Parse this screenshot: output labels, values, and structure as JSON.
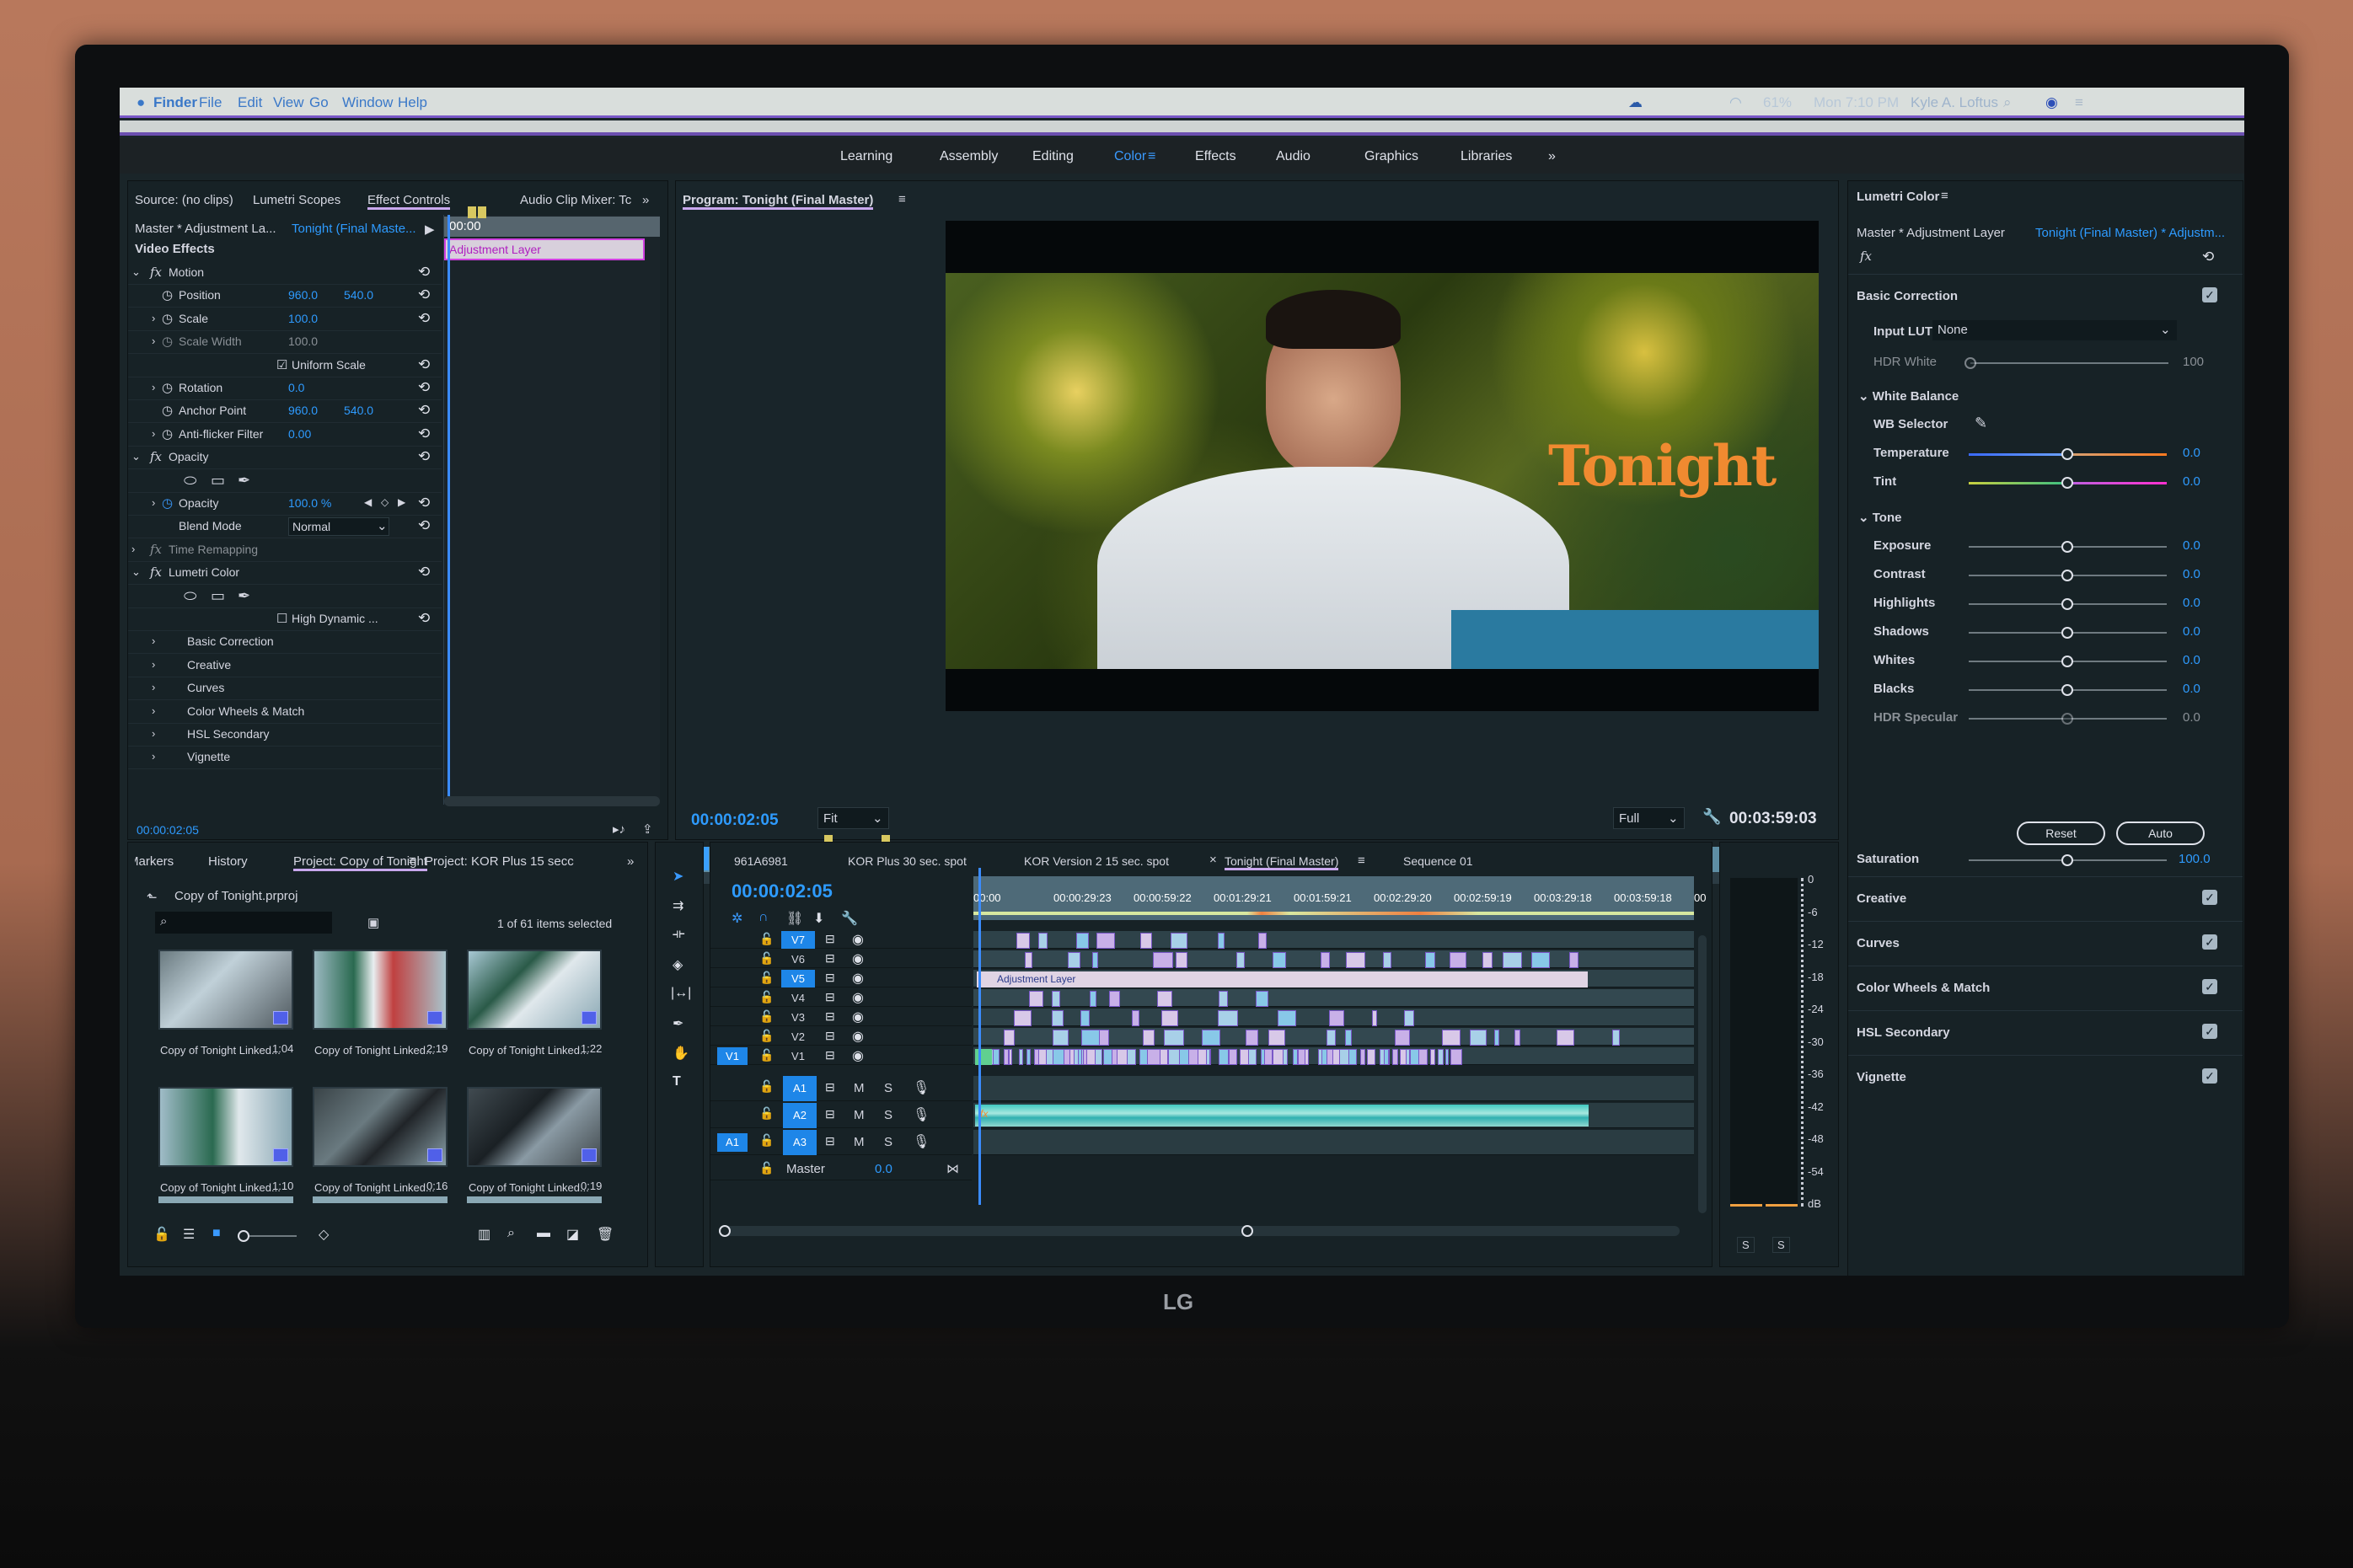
{
  "menubar": {
    "apple": "",
    "items": [
      "Finder",
      "File",
      "Edit",
      "View",
      "Go",
      "Window",
      "Help"
    ],
    "battery": "61%",
    "clock": "Mon 7:10 PM",
    "user": "Kyle A. Loftus"
  },
  "workspaces": {
    "items": [
      "Learning",
      "Assembly",
      "Editing",
      "Color",
      "Effects",
      "Audio",
      "Graphics",
      "Libraries"
    ],
    "active": "Color",
    "more": "»"
  },
  "left_panel": {
    "tabs": [
      "Source: (no clips)",
      "Lumetri Scopes",
      "Effect Controls",
      "Audio Clip Mixer: Tc"
    ],
    "active_tab": "Effect Controls",
    "master": "Master * Adjustment La...",
    "sequence": "Tonight (Final Maste...",
    "timeline_start": "00:00",
    "clip_label": "Adjustment Layer",
    "section": "Video Effects",
    "rows": [
      {
        "indent": 1,
        "label": "Motion",
        "fx": true
      },
      {
        "indent": 2,
        "label": "Position",
        "v1": "960.0",
        "v2": "540.0"
      },
      {
        "indent": 2,
        "label": "Scale",
        "v1": "100.0"
      },
      {
        "indent": 2,
        "label": "Scale Width",
        "v1": "100.0",
        "disabled": true
      },
      {
        "indent": 3,
        "label": "Uniform Scale",
        "checkbox": true,
        "checked": true
      },
      {
        "indent": 2,
        "label": "Rotation",
        "v1": "0.0"
      },
      {
        "indent": 2,
        "label": "Anchor Point",
        "v1": "960.0",
        "v2": "540.0"
      },
      {
        "indent": 2,
        "label": "Anti-flicker Filter",
        "v1": "0.00"
      },
      {
        "indent": 1,
        "label": "Opacity",
        "fx": true
      },
      {
        "indent": 2,
        "label": "",
        "masks": true
      },
      {
        "indent": 2,
        "label": "Opacity",
        "v1": "100.0 %"
      },
      {
        "indent": 2,
        "label": "Blend Mode",
        "select": "Normal"
      },
      {
        "indent": 1,
        "label": "Time Remapping",
        "fx": true,
        "disabled": true
      },
      {
        "indent": 1,
        "label": "Lumetri Color",
        "fx": true
      },
      {
        "indent": 2,
        "label": "",
        "masks": true
      },
      {
        "indent": 3,
        "label": "High Dynamic ...",
        "checkbox": true,
        "checked": false
      },
      {
        "indent": 2,
        "label": "Basic Correction"
      },
      {
        "indent": 2,
        "label": "Creative"
      },
      {
        "indent": 2,
        "label": "Curves"
      },
      {
        "indent": 2,
        "label": "Color Wheels & Match"
      },
      {
        "indent": 2,
        "label": "HSL Secondary"
      },
      {
        "indent": 2,
        "label": "Vignette"
      }
    ],
    "timecode": "00:00:02:05"
  },
  "program": {
    "title": "Program: Tonight (Final Master)",
    "overlay_text": "Tonight",
    "timecode": "00:00:02:05",
    "zoom": "Fit",
    "quality": "Full",
    "duration": "00:03:59:03",
    "playhead_fraction": 0.01
  },
  "lumetri": {
    "title": "Lumetri Color",
    "master": "Master * Adjustment Layer",
    "sequence": "Tonight (Final Master) * Adjustm...",
    "basic_correction": "Basic Correction",
    "input_lut_label": "Input LUT",
    "input_lut": "None",
    "hdr_white_label": "HDR White",
    "hdr_white": "100",
    "white_balance": "White Balance",
    "wb_selector": "WB Selector",
    "wb_sliders": [
      {
        "label": "Temperature",
        "value": "0.0"
      },
      {
        "label": "Tint",
        "value": "0.0"
      }
    ],
    "tone": "Tone",
    "tone_sliders": [
      {
        "label": "Exposure",
        "value": "0.0"
      },
      {
        "label": "Contrast",
        "value": "0.0"
      },
      {
        "label": "Highlights",
        "value": "0.0"
      },
      {
        "label": "Shadows",
        "value": "0.0"
      },
      {
        "label": "Whites",
        "value": "0.0"
      },
      {
        "label": "Blacks",
        "value": "0.0"
      },
      {
        "label": "HDR Specular",
        "value": "0.0",
        "disabled": true
      }
    ],
    "reset": "Reset",
    "auto": "Auto",
    "saturation_label": "Saturation",
    "saturation": "100.0",
    "sections": [
      {
        "label": "Creative",
        "checked": true
      },
      {
        "label": "Curves",
        "checked": true
      },
      {
        "label": "Color Wheels & Match",
        "checked": true
      },
      {
        "label": "HSL Secondary",
        "checked": true
      },
      {
        "label": "Vignette",
        "checked": true
      }
    ]
  },
  "project": {
    "tabs": [
      "Markers",
      "History",
      "Project: Copy of Tonight",
      "Project: KOR Plus 15 secc"
    ],
    "active_tab": "Project: Copy of Tonight",
    "file": "Copy of Tonight.prproj",
    "search_placeholder": "",
    "selection": "1 of 61 items selected",
    "items": [
      {
        "name": "Copy of Tonight Linked...",
        "dur": "1:04"
      },
      {
        "name": "Copy of Tonight Linked...",
        "dur": "2:19"
      },
      {
        "name": "Copy of Tonight Linked...",
        "dur": "1:22"
      },
      {
        "name": "Copy of Tonight Linked...",
        "dur": "1:10"
      },
      {
        "name": "Copy of Tonight Linked...",
        "dur": "0:16"
      },
      {
        "name": "Copy of Tonight Linked...",
        "dur": "0:19"
      }
    ]
  },
  "timeline": {
    "tabs": [
      "961A6981",
      "KOR Plus 30 sec. spot",
      "KOR Version 2 15 sec. spot",
      "Tonight (Final Master)",
      "Sequence 01"
    ],
    "active_tab": "Tonight (Final Master)",
    "close": "×",
    "timecode": "00:00:02:05",
    "ruler": [
      "00:00",
      "00:00:29:23",
      "00:00:59:22",
      "00:01:29:21",
      "00:01:59:21",
      "00:02:29:20",
      "00:02:59:19",
      "00:03:29:18",
      "00:03:59:18",
      "00"
    ],
    "video_tracks": [
      "V7",
      "V6",
      "V5",
      "V4",
      "V3",
      "V2",
      "V1"
    ],
    "audio_tracks": [
      "A1",
      "A2",
      "A3"
    ],
    "source_video": "V1",
    "source_audio": "A1",
    "master_label": "Master",
    "master_value": "0.0",
    "adjustment_clip": "Adjustment Layer",
    "mute": "M",
    "solo": "S"
  },
  "meter": {
    "ticks": [
      "0",
      "-6",
      "-12",
      "-18",
      "-24",
      "-30",
      "-36",
      "-42",
      "-48",
      "-54",
      "dB"
    ],
    "solo": [
      "S",
      "S"
    ]
  },
  "brand": "LG"
}
